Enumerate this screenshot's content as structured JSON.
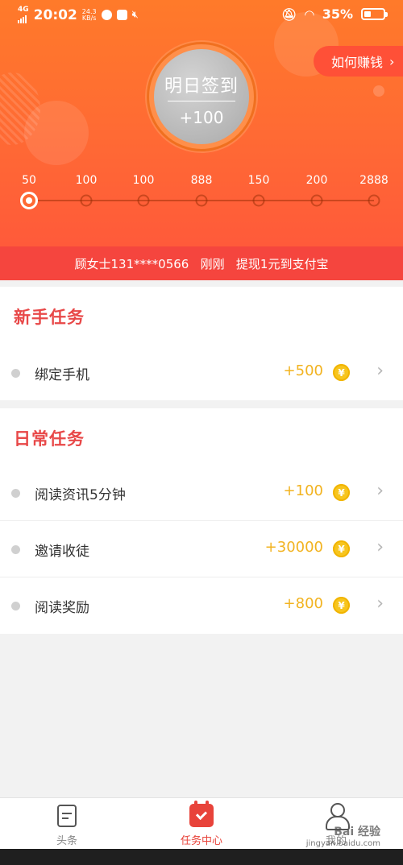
{
  "status_bar": {
    "network": "4G",
    "time": "20:02",
    "speed_value": "24.3",
    "speed_unit": "KB/s",
    "battery": "35%",
    "battery_level": 0.35
  },
  "checkin": {
    "title": "明日签到",
    "points": "+100"
  },
  "how_to_earn": {
    "label": "如何赚钱",
    "arrow": "›"
  },
  "milestones": [
    {
      "label": "50",
      "active": true
    },
    {
      "label": "100",
      "active": false
    },
    {
      "label": "100",
      "active": false
    },
    {
      "label": "888",
      "active": false
    },
    {
      "label": "150",
      "active": false
    },
    {
      "label": "200",
      "active": false
    },
    {
      "label": "2888",
      "active": false
    }
  ],
  "ticker": {
    "text": "顾女士131****0566   刚刚   提现1元到支付宝"
  },
  "sections": {
    "newbie": {
      "title": "新手任务",
      "tasks": [
        {
          "name": "绑定手机",
          "reward": "+500"
        }
      ]
    },
    "daily": {
      "title": "日常任务",
      "tasks": [
        {
          "name": "阅读资讯5分钟",
          "reward": "+100"
        },
        {
          "name": "邀请收徒",
          "reward": "+30000"
        },
        {
          "name": "阅读奖励",
          "reward": "+800"
        }
      ]
    }
  },
  "coin_symbol": "¥",
  "chevron": "›",
  "tabs": [
    {
      "label": "头条",
      "icon": "document-icon",
      "active": false
    },
    {
      "label": "任务中心",
      "icon": "calendar-check-icon",
      "active": true
    },
    {
      "label": "我的",
      "icon": "user-icon",
      "active": false
    }
  ],
  "watermark": {
    "brand": "Bai 经验",
    "url": "jingyan.baidu.com"
  },
  "colors": {
    "accent_red": "#e84848",
    "reward_gold": "#f2b320",
    "hero_orange": "#ff7a2a",
    "ticker_red": "#f5453e"
  }
}
